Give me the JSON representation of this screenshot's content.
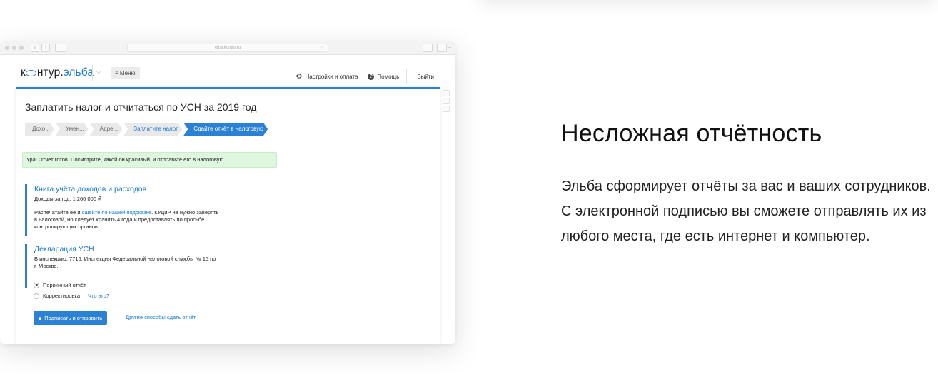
{
  "browser": {
    "url": "elba.kontur.ru"
  },
  "app": {
    "logo_prefix": "к",
    "logo_mid": "нтур.",
    "logo_brand": "эльба",
    "menu_label": "≡ Меню",
    "settings_label": "Настройки и оплата",
    "help_label": "Помощь",
    "logout_label": "Выйти"
  },
  "page": {
    "title": "Заплатить налог и отчитаться по УСН за 2019 год",
    "steps": [
      {
        "label": "Дохо...",
        "state": "done"
      },
      {
        "label": "Умен...",
        "state": "done"
      },
      {
        "label": "Адре...",
        "state": "done"
      },
      {
        "label": "Заплатите налог",
        "state": "link"
      },
      {
        "label": "Сдайте отчёт в налоговую",
        "state": "active"
      }
    ],
    "success_message": "Ура! Отчёт готов. Посмотрите, какой он красивый, и отправьте его в налоговую.",
    "book": {
      "title": "Книга учёта доходов и расходов",
      "income": "Доходы за год: 1 260 000 ₽",
      "note_pre": "Распечатайте её и ",
      "note_link": "сшейте по нашей подсказке",
      "note_post": ". КУДиР не нужно заверять",
      "note_line2": "в налоговой, но следует хранить 4 года и предоставлять по просьбе",
      "note_line3": "контролирующих органов."
    },
    "declaration": {
      "title": "Декларация УСН",
      "line1": "В инспекцию: 7715, Инспекция Федеральной налоговой службы № 15 по",
      "line2": "г. Москве.",
      "option_primary": "Первичный отчёт",
      "option_correction": "Корректировка",
      "whats_this": "Что это?",
      "selected": "Первичный отчёт"
    },
    "sign_button": "Подписать и отправить",
    "other_ways_link": "Другие способы сдать отчёт"
  },
  "promo": {
    "headline": "Несложная отчётность",
    "description": "Эльба сформирует отчёты за вас и ваших сотрудников. С электронной подписью вы сможете отправлять их из любого места, где есть интернет и компьютер."
  },
  "colors": {
    "accent": "#2b82d4",
    "link": "#1a7bd0",
    "success_bg": "#dff6df"
  }
}
